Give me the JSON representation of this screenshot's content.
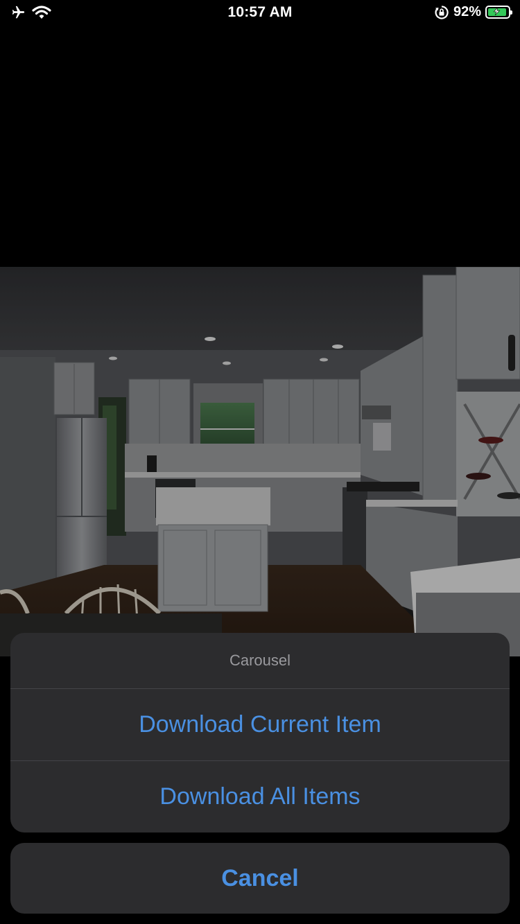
{
  "status_bar": {
    "time": "10:57 AM",
    "battery_percent": "92%",
    "battery_level": 0.92,
    "icons": [
      "airplane-icon",
      "wifi-icon",
      "orientation-lock-icon",
      "battery-charging-icon"
    ]
  },
  "action_sheet": {
    "title": "Carousel",
    "options": [
      {
        "label": "Download Current Item"
      },
      {
        "label": "Download All Items"
      }
    ],
    "cancel_label": "Cancel",
    "colors": {
      "action": "#4a90e2",
      "sheet_background": "#2c2c2e",
      "title": "#9a9a9e"
    }
  }
}
